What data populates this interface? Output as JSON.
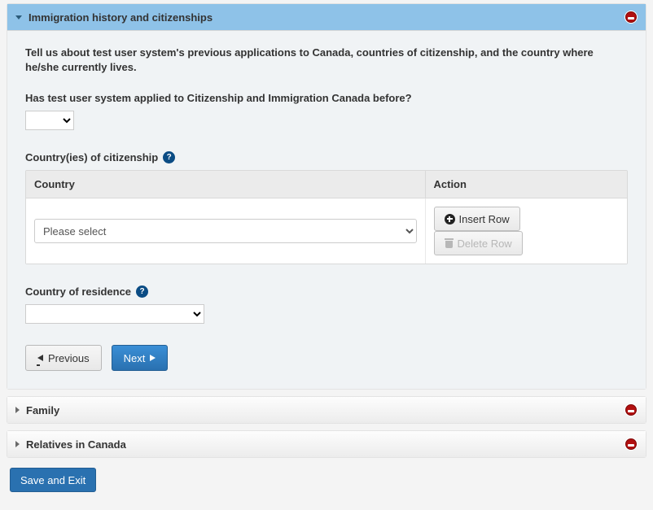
{
  "sections": {
    "immigration": {
      "title": "Immigration history and citizenships",
      "intro": "Tell us about test user system's previous applications to Canada, countries of citizenship, and the country where he/she currently lives.",
      "applied_before_label": "Has test user system applied to Citizenship and Immigration Canada before?",
      "applied_before_value": "",
      "citizenship_label": "Country(ies) of citizenship",
      "table": {
        "col_country": "Country",
        "col_action": "Action",
        "row_select_placeholder": "Please select",
        "insert_label": "Insert Row",
        "delete_label": "Delete Row"
      },
      "residence_label": "Country of residence",
      "residence_value": "",
      "nav": {
        "previous": "Previous",
        "next": "Next"
      }
    },
    "family": {
      "title": "Family"
    },
    "relatives": {
      "title": "Relatives in Canada"
    }
  },
  "footer": {
    "save_exit": "Save and Exit"
  }
}
